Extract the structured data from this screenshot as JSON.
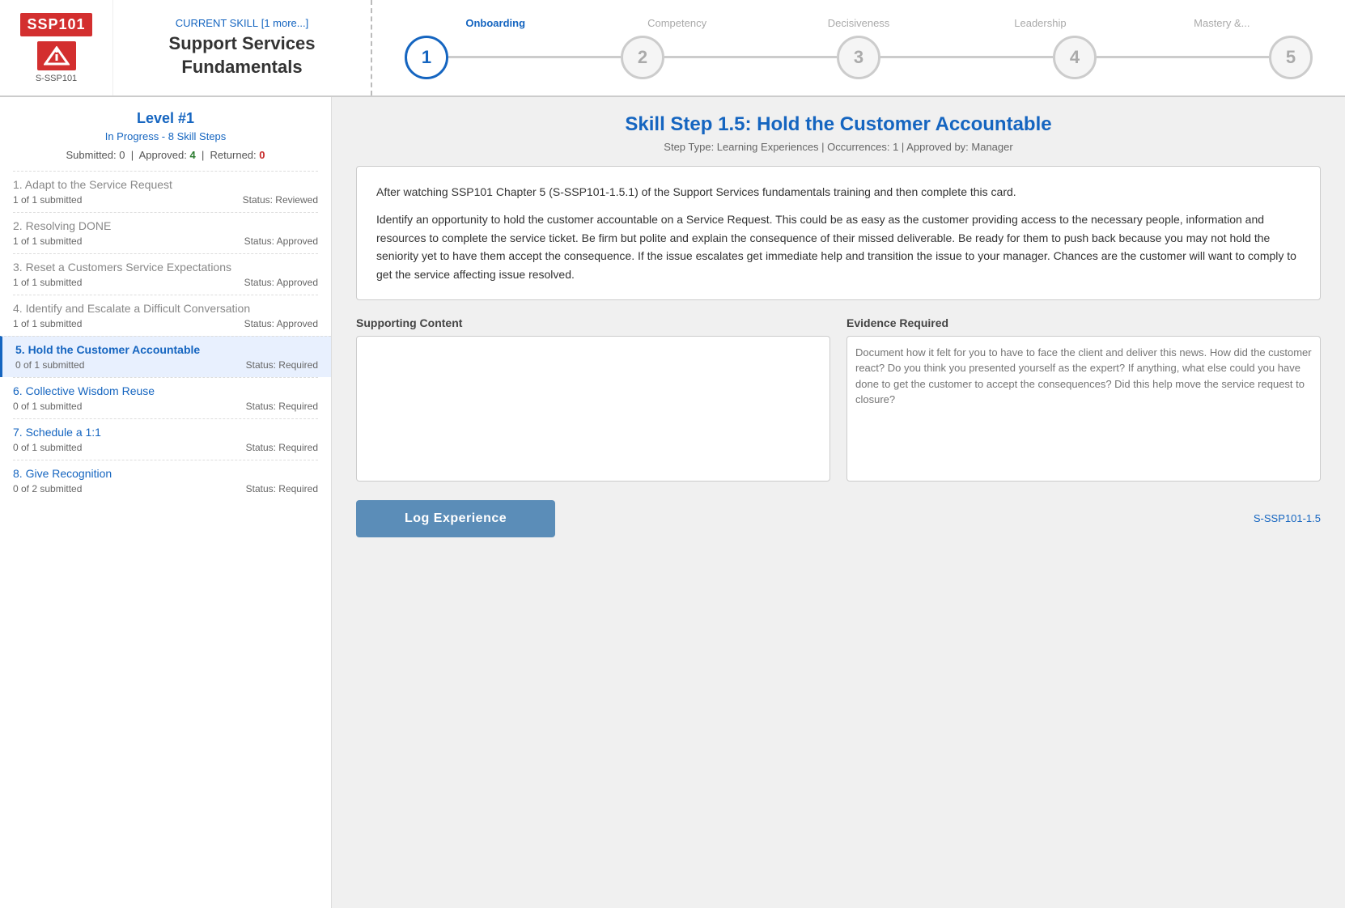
{
  "header": {
    "logo_text": "SSP101",
    "logo_subtitle": "S-SSP101",
    "current_skill_label": "CURRENT SKILL",
    "more_label": "[1 more...]",
    "skill_name_line1": "Support Services",
    "skill_name_line2": "Fundamentals"
  },
  "stepper": {
    "labels": [
      "Onboarding",
      "Competency",
      "Decisiveness",
      "Leadership",
      "Mastery &..."
    ],
    "active_index": 0,
    "nodes": [
      "1",
      "2",
      "3",
      "4",
      "5"
    ]
  },
  "sidebar": {
    "title": "Level #1",
    "progress": "In Progress - 8 Skill Steps",
    "stats_submitted": "Submitted: 0",
    "stats_approved_label": "Approved:",
    "stats_approved_value": "4",
    "stats_returned_label": "Returned:",
    "stats_returned_value": "0",
    "items": [
      {
        "title": "1. Adapt to the Service Request",
        "submitted": "1 of 1 submitted",
        "status": "Status: Reviewed",
        "type": "reviewed"
      },
      {
        "title": "2. Resolving DONE",
        "submitted": "1 of 1 submitted",
        "status": "Status: Approved",
        "type": "reviewed"
      },
      {
        "title": "3. Reset a Customers Service Expectations",
        "submitted": "1 of 1 submitted",
        "status": "Status: Approved",
        "type": "reviewed"
      },
      {
        "title": "4. Identify and Escalate a Difficult Conversation",
        "submitted": "1 of 1 submitted",
        "status": "Status: Approved",
        "type": "reviewed"
      },
      {
        "title": "5. Hold the Customer Accountable",
        "submitted": "0 of 1 submitted",
        "status": "Status: Required",
        "type": "active"
      },
      {
        "title": "6. Collective Wisdom Reuse",
        "submitted": "0 of 1 submitted",
        "status": "Status: Required",
        "type": "link"
      },
      {
        "title": "7. Schedule a 1:1",
        "submitted": "0 of 1 submitted",
        "status": "Status: Required",
        "type": "link"
      },
      {
        "title": "8. Give Recognition",
        "submitted": "0 of 2 submitted",
        "status": "Status: Required",
        "type": "link"
      }
    ]
  },
  "main": {
    "step_title": "Skill Step 1.5: Hold the Customer Accountable",
    "step_meta": "Step Type: Learning Experiences | Occurrences: 1 | Approved by: Manager",
    "description_p1": "After watching SSP101 Chapter 5 (S-SSP101-1.5.1) of the Support Services fundamentals training and then complete this card.",
    "description_p2": "Identify an opportunity to hold the customer accountable on a Service Request. This could be as easy as the customer providing access to the necessary people, information and resources to complete the service ticket. Be firm but polite and explain the consequence of their missed deliverable. Be ready for them to push back because you may not hold the seniority yet to have them accept the consequence. If the issue escalates get immediate help and transition the issue to your manager. Chances are the customer will want to comply to get the service affecting issue resolved.",
    "supporting_content_label": "Supporting Content",
    "evidence_label": "Evidence Required",
    "evidence_placeholder": "Document how it felt for you to have to face the client and deliver this news. How did the customer react? Do you think you presented yourself as the expert? If anything, what else could you have done to get the customer to accept the consequences? Did this help move the service request to closure?",
    "log_button": "Log Experience",
    "step_ref": "S-SSP101-1.5"
  }
}
